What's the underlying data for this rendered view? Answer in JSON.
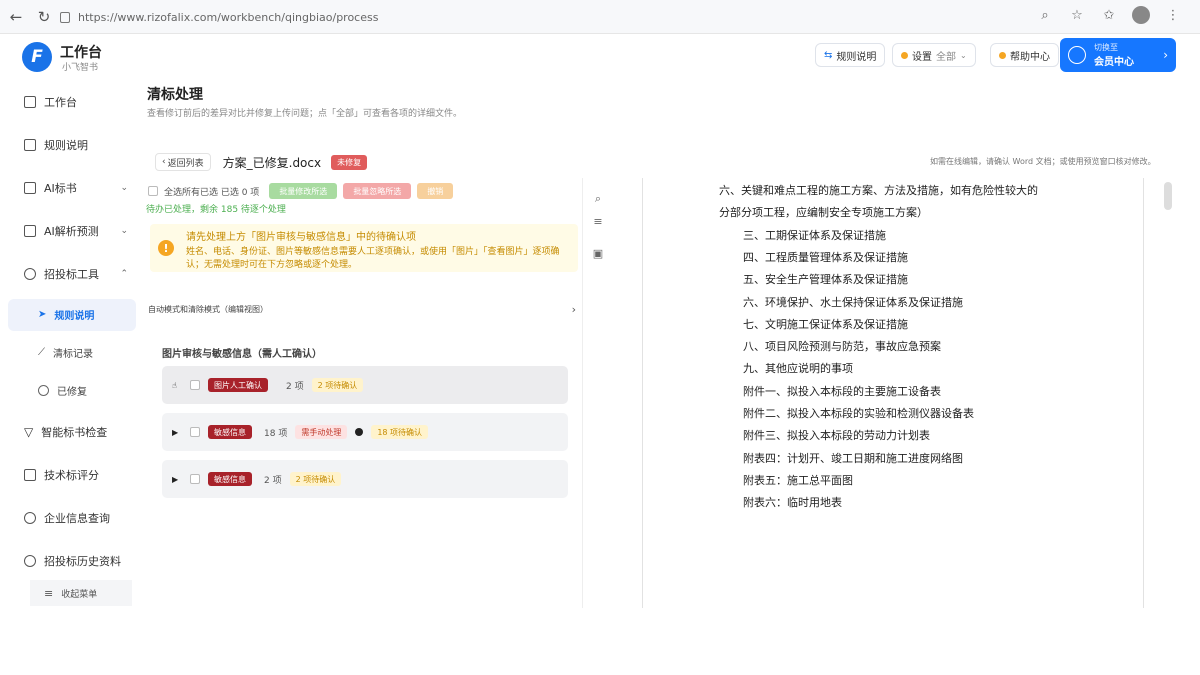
{
  "browser": {
    "url": "https://www.rizofalix.com/workbench/qingbiao/process"
  },
  "app": {
    "title": "工作台",
    "subtitle": "小飞智书"
  },
  "header": {
    "btn1": "规则说明",
    "btn2_label": "设置",
    "btn2_value": "全部",
    "btn3": "帮助中心",
    "user_top": "切换至",
    "user_bottom": "会员中心"
  },
  "sidebar": {
    "items": [
      {
        "label": "工作台"
      },
      {
        "label": "规则说明"
      },
      {
        "label": "AI标书"
      },
      {
        "label": "AI解析预测"
      },
      {
        "label": "招投标工具"
      },
      {
        "label": "智能标书检查"
      },
      {
        "label": "技术标评分"
      },
      {
        "label": "企业信息查询"
      },
      {
        "label": "招投标历史资料"
      }
    ],
    "subitems": [
      {
        "label": "规则说明"
      },
      {
        "label": "清标记录"
      },
      {
        "label": "已修复"
      }
    ],
    "bottom": "收起菜单"
  },
  "page": {
    "title": "清标处理",
    "desc": "查看修订前后的差异对比并修复上传问题；点「全部」可查看各项的详细文件。"
  },
  "doc": {
    "back": "返回列表",
    "name": "方案_已修复.docx",
    "badge": "未修复",
    "meta": "如需在线编辑，请确认 Word 文档；或使用预览窗口核对修改。"
  },
  "left": {
    "select_all": "全选所有已选 已选 0 项",
    "pill1": "批量修改所选",
    "pill2": "批量忽略所选",
    "pill3": "撤销",
    "hint": "待办已处理，剩余 185 待逐个处理",
    "notice_title": "请先处理上方「图片审核与敏感信息」中的待确认项",
    "notice_body": "姓名、电话、身份证、图片等敏感信息需要人工逐项确认，或使用「图片」「查看图片」逐项确认；无需处理时可在下方忽略或逐个处理。",
    "mode": "自动模式和清除模式（编辑视图）",
    "section_title": "图片审核与敏感信息（需人工确认）",
    "groups": [
      {
        "tag": "图片人工确认",
        "count": "2 项",
        "pending": "2 项待确认"
      },
      {
        "tag": "敏感信息",
        "count": "18 项",
        "edit": "需手动处理",
        "pending": "18 项待确认"
      },
      {
        "tag": "敏感信息",
        "count": "2 项",
        "pending": "2 项待确认"
      }
    ]
  },
  "document_lines": [
    "六、关键和难点工程的施工方案、方法及措施，如有危险性较大的",
    "分部分项工程，应编制安全专项施工方案）",
    "三、工期保证体系及保证措施",
    "四、工程质量管理体系及保证措施",
    "五、安全生产管理体系及保证措施",
    "六、环境保护、水土保持保证体系及保证措施",
    "七、文明施工保证体系及保证措施",
    "八、项目风险预测与防范，事故应急预案",
    "九、其他应说明的事项",
    "附件一、拟投入本标段的主要施工设备表",
    "附件二、拟投入本标段的实验和检测仪器设备表",
    "附件三、拟投入本标段的劳动力计划表",
    "附表四：计划开、竣工日期和施工进度网络图",
    "附表五：施工总平面图",
    "附表六：临时用地表"
  ],
  "colors": {
    "accent": "#1677ff",
    "tag_red": "#a8222a",
    "warning": "#f5a623"
  }
}
